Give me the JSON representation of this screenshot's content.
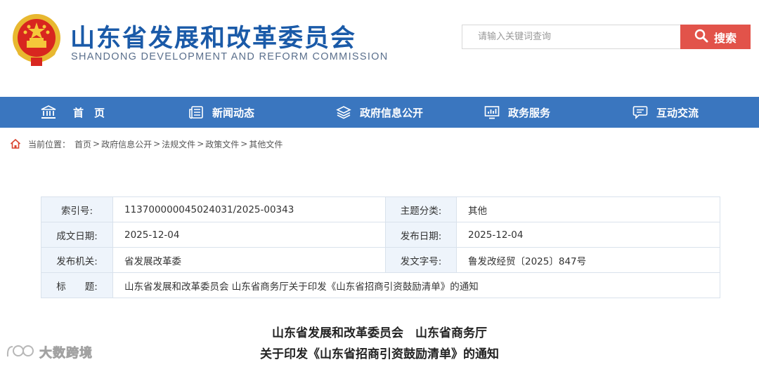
{
  "header": {
    "site_title": "山东省发展和改革委员会",
    "site_subtitle": "SHANDONG DEVELOPMENT AND REFORM COMMISSION",
    "logo_name": "national-emblem",
    "search": {
      "placeholder": "请输入关键词查询",
      "button_label": "搜索",
      "icon": "search-icon"
    }
  },
  "nav": {
    "items": [
      {
        "label": "首　页",
        "icon": "home-building-icon"
      },
      {
        "label": "新闻动态",
        "icon": "newspaper-icon"
      },
      {
        "label": "政府信息公开",
        "icon": "layers-icon"
      },
      {
        "label": "政务服务",
        "icon": "monitor-chart-icon"
      },
      {
        "label": "互动交流",
        "icon": "chat-bubble-icon"
      }
    ]
  },
  "breadcrumb": {
    "prefix": "当前位置：",
    "items": [
      "首页",
      "政府信息公开",
      "法规文件",
      "政策文件",
      "其他文件"
    ],
    "separator": ">"
  },
  "info": {
    "index_label": "索引号:",
    "index_value": "11370000004502403​1/2025-00343",
    "category_label": "主题分类:",
    "category_value": "其他",
    "written_date_label": "成文日期:",
    "written_date_value": "2025-12-04",
    "publish_date_label": "发布日期:",
    "publish_date_value": "2025-12-04",
    "issuer_label": "发布机关:",
    "issuer_value": "省发展改革委",
    "doc_number_label": "发文字号:",
    "doc_number_value": "鲁发改经贸〔2025〕847号",
    "title_label": "标　　题:",
    "title_value": "山东省发展和改革委员会 山东省商务厅关于印发《山东省招商引资鼓励清单》的通知"
  },
  "document": {
    "title_line1": "山东省发展和改革委员会　山东省商务厅",
    "title_line2": "关于印发《山东省招商引资鼓励清单》的通知"
  },
  "watermark": {
    "text": "大数跨境"
  },
  "colors": {
    "brand_blue": "#1a5aa8",
    "nav_blue": "#3a76bf",
    "search_red": "#e2534a",
    "label_bg": "#eef4fb"
  }
}
